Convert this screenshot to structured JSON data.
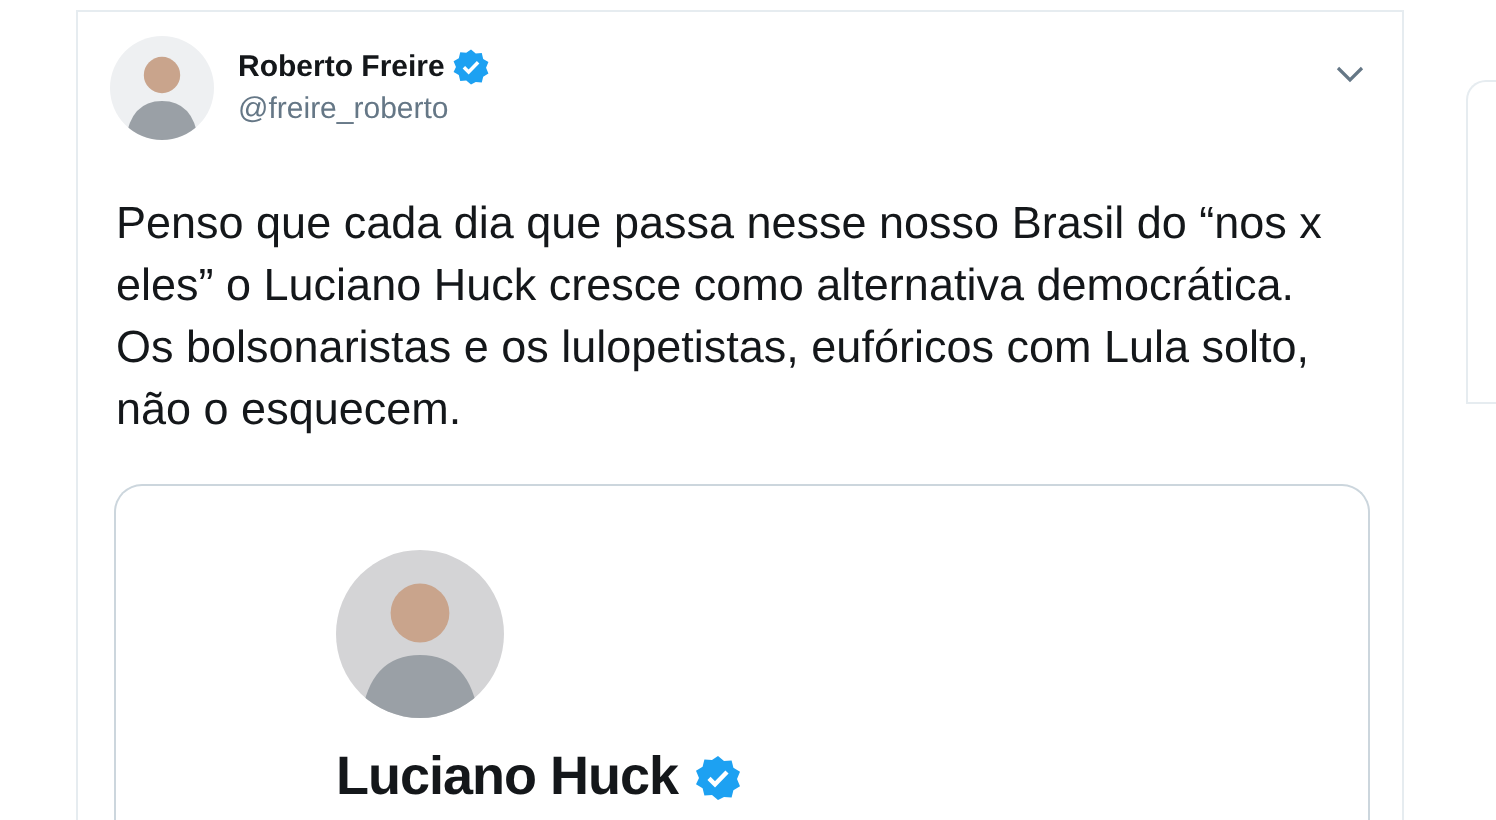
{
  "tweet": {
    "author": {
      "name": "Roberto Freire",
      "handle": "@freire_roberto",
      "verified": true
    },
    "text": "Penso que cada dia que passa nesse nosso Brasil do “nos x eles” o Luciano Huck cresce como alternativa democrática. Os bolsonaristas e os lulopetistas, eufóricos com Lula solto, não o esquecem.",
    "embed": {
      "name": "Luciano Huck",
      "verified": true
    }
  }
}
